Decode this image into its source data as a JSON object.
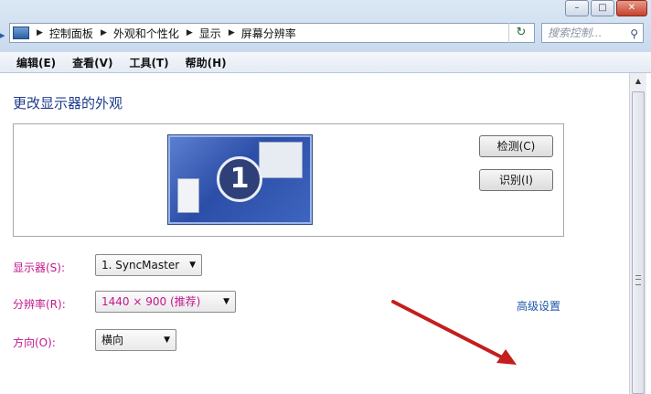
{
  "window": {
    "controls": [
      "–",
      "□",
      "✕"
    ]
  },
  "address_bar": {
    "crumbs": [
      "控制面板",
      "外观和个性化",
      "显示",
      "屏幕分辨率"
    ],
    "back_glyph": "▸",
    "search_placeholder": "搜索控制..."
  },
  "menu": [
    "编辑(E)",
    "查看(V)",
    "工具(T)",
    "帮助(H)"
  ],
  "content": {
    "heading": "更改显示器的外观",
    "monitor_number": "1",
    "detect_button": "检测(C)",
    "identify_button": "识别(I)",
    "display_label": "显示器(S):",
    "display_value": "1. SyncMaster",
    "resolution_label": "分辨率(R):",
    "resolution_value": "1440 × 900 (推荐)",
    "orientation_label": "方向(O):",
    "orientation_value": "横向",
    "advanced_link": "高级设置"
  },
  "icons": {
    "back": "chevron-right-icon",
    "location": "control-panel-icon",
    "refresh": "refresh-icon",
    "search": "search-icon"
  },
  "colors": {
    "heading": "#1e3a8a",
    "label_accent": "#c2188b",
    "link": "#1e56a8",
    "annotation_arrow": "#c41e1e"
  }
}
